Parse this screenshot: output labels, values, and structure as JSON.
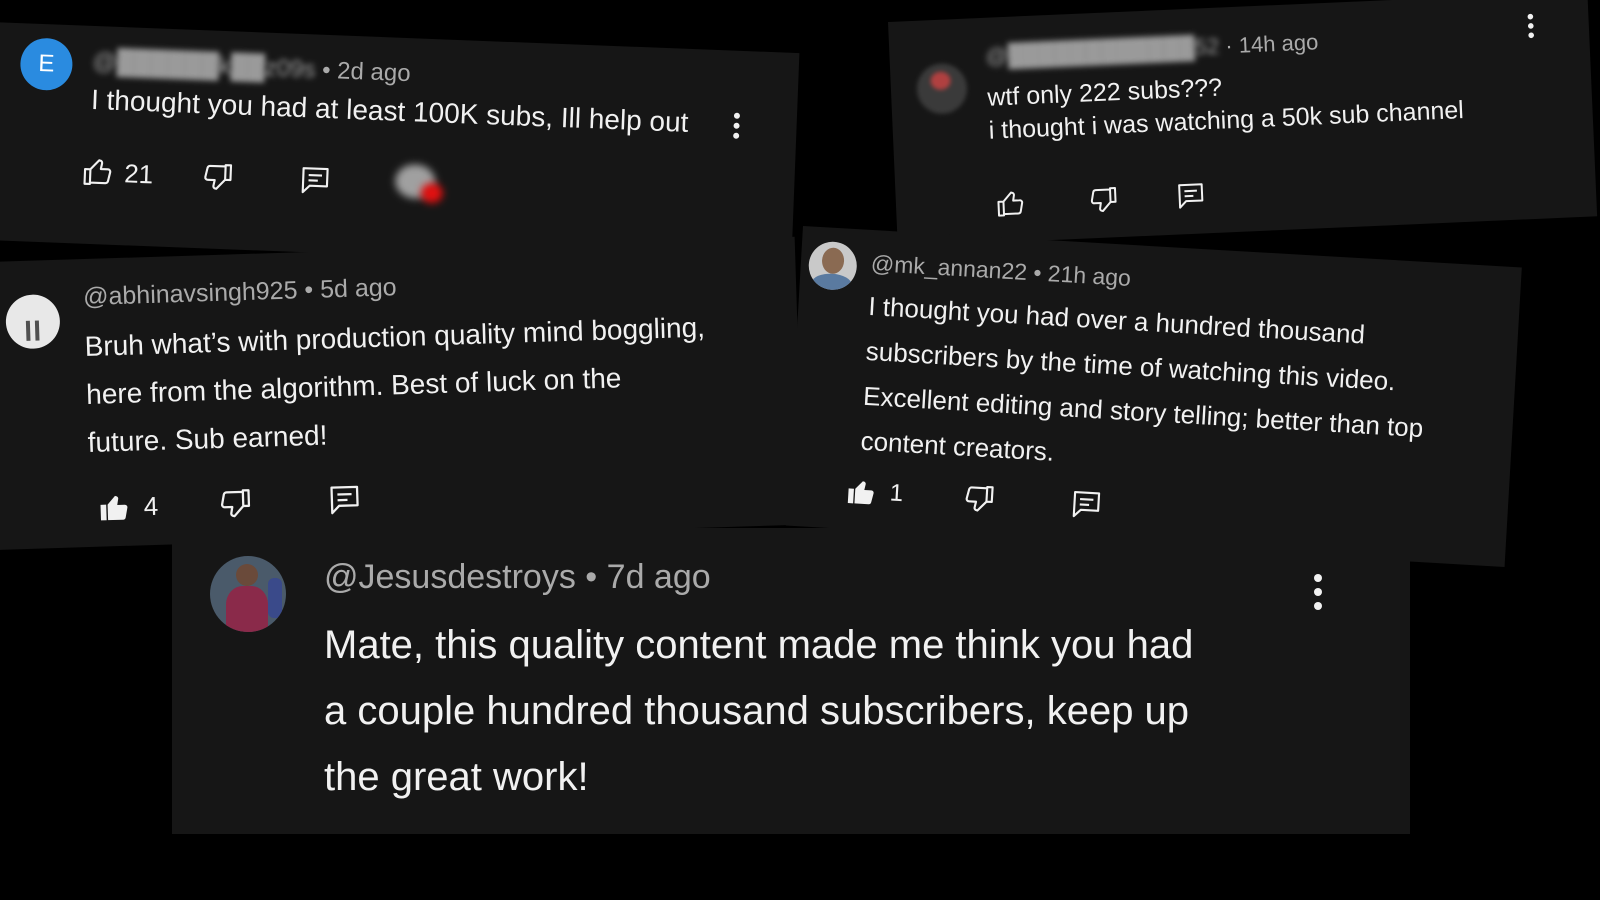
{
  "colors": {
    "background": "#000000",
    "card": "#161616",
    "text": "#f1f1f1",
    "meta": "#aaaaaa",
    "avatar_blue": "#2a8be0",
    "heart_red": "#e01010"
  },
  "icons": {
    "like": "thumbs-up-icon",
    "like_filled": "thumbs-up-filled-icon",
    "dislike": "thumbs-down-icon",
    "reply": "comment-reply-icon",
    "more": "more-vert-icon"
  },
  "comments": [
    {
      "avatar_letter": "E",
      "handle_blurred": "@██████k██z09s",
      "separator": "•",
      "time": "2d ago",
      "lines": [
        "I thought you had at least 100K subs, Ill help out"
      ],
      "likes": "21"
    },
    {
      "handle_blurred": "@████████████52",
      "separator": "·",
      "time": "14h ago",
      "lines": [
        "wtf only 222 subs???",
        "i thought i was watching a 50k sub channel"
      ]
    },
    {
      "handle": "@abhinavsingh925",
      "separator": "•",
      "time": "5d ago",
      "lines": [
        "Bruh what’s with production quality mind boggling,",
        "here from the algorithm. Best of luck on the",
        "future. Sub earned!"
      ],
      "likes": "4"
    },
    {
      "handle": "@mk_annan22",
      "separator": "•",
      "time": "21h ago",
      "lines": [
        "I thought you had over a hundred thousand",
        "subscribers by the time of watching this video.",
        "Excellent editing and story telling; better than top",
        "content creators."
      ],
      "likes": "1"
    },
    {
      "handle": "@Jesusdestroys",
      "separator": "•",
      "time": "7d ago",
      "lines": [
        "Mate, this quality content made me think you had",
        "a couple hundred thousand subscribers, keep up",
        "the great work!"
      ]
    }
  ]
}
